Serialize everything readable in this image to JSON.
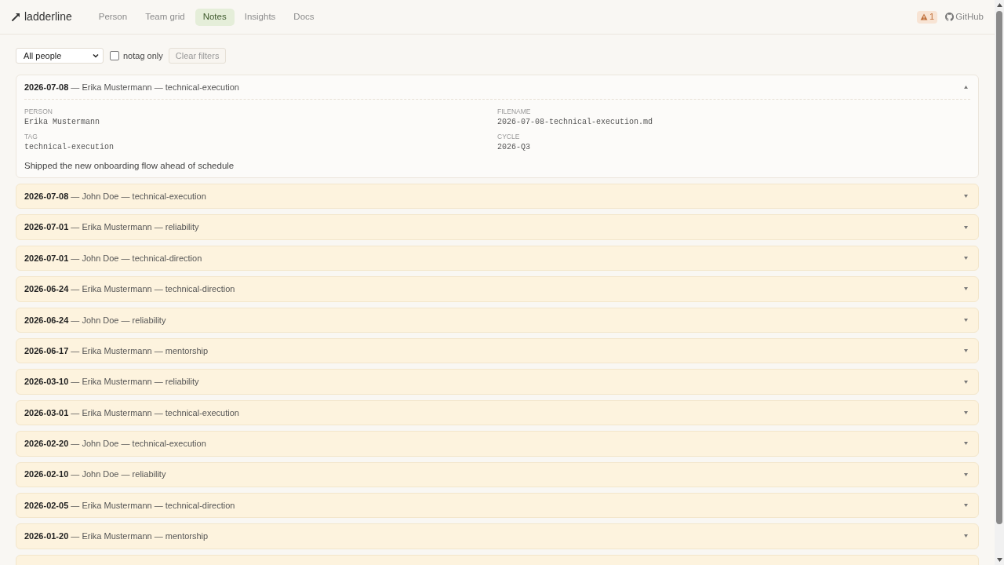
{
  "brand": {
    "name": "ladderline"
  },
  "nav": [
    {
      "label": "Person",
      "selected": false
    },
    {
      "label": "Team grid",
      "selected": false
    },
    {
      "label": "Notes",
      "selected": true
    },
    {
      "label": "Insights",
      "selected": false
    },
    {
      "label": "Docs",
      "selected": false
    }
  ],
  "alerts": {
    "count": "1"
  },
  "github": {
    "label": "GitHub"
  },
  "filters": {
    "person_select": {
      "value": "All people"
    },
    "notag_checkbox": {
      "label": "notag only",
      "checked": false
    },
    "clear_button": {
      "label": "Clear filters"
    }
  },
  "notes": [
    {
      "title": "**2026-07-08** — Erika Mustermann — technical-execution",
      "expanded": true,
      "fields": [
        {
          "label": "PERSON",
          "value": "Erika Mustermann"
        },
        {
          "label": "FILENAME",
          "value": "2026-07-08-technical-execution.md"
        },
        {
          "label": "TAG",
          "value": "technical-execution"
        },
        {
          "label": "CYCLE",
          "value": "2026-Q3"
        }
      ],
      "body": "Shipped the new onboarding flow ahead of schedule"
    },
    {
      "title": "**2026-07-08** — John Doe — technical-execution",
      "expanded": false
    },
    {
      "title": "**2026-07-01** — Erika Mustermann — reliability",
      "expanded": false
    },
    {
      "title": "**2026-07-01** — John Doe — technical-direction",
      "expanded": false
    },
    {
      "title": "**2026-06-24** — Erika Mustermann — technical-direction",
      "expanded": false
    },
    {
      "title": "**2026-06-24** — John Doe — reliability",
      "expanded": false
    },
    {
      "title": "**2026-06-17** — Erika Mustermann — mentorship",
      "expanded": false
    },
    {
      "title": "**2026-03-10** — Erika Mustermann — reliability",
      "expanded": false
    },
    {
      "title": "**2026-03-01** — Erika Mustermann — technical-execution",
      "expanded": false
    },
    {
      "title": "**2026-02-20** — John Doe — technical-execution",
      "expanded": false
    },
    {
      "title": "**2026-02-10** — John Doe — reliability",
      "expanded": false
    },
    {
      "title": "**2026-02-05** — Erika Mustermann — technical-direction",
      "expanded": false
    },
    {
      "title": "**2026-01-20** — Erika Mustermann — mentorship",
      "expanded": false
    },
    {
      "expanded": false
    }
  ]
}
